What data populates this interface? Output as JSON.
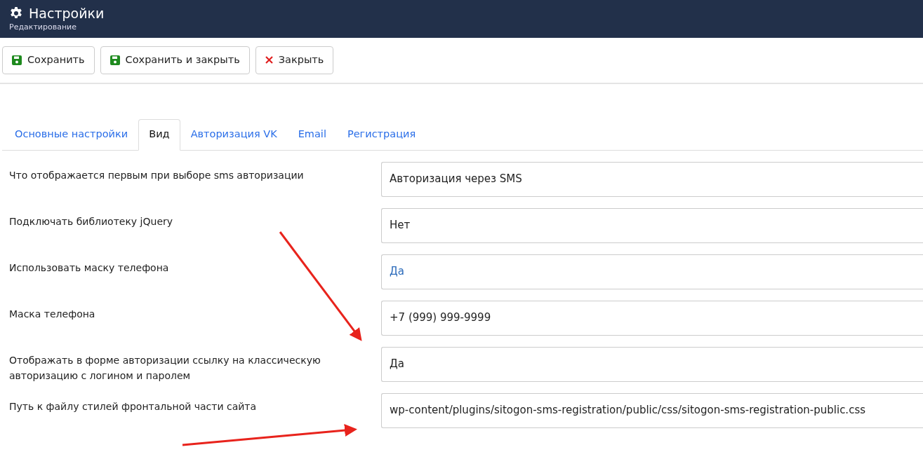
{
  "header": {
    "title": "Настройки",
    "subtitle": "Редактирование"
  },
  "toolbar": [
    {
      "label": "Сохранить",
      "kind": "save"
    },
    {
      "label": "Сохранить и закрыть",
      "kind": "save"
    },
    {
      "label": "Закрыть",
      "kind": "close"
    }
  ],
  "tabs": [
    {
      "label": "Основные настройки",
      "selected": false
    },
    {
      "label": "Вид",
      "selected": true
    },
    {
      "label": "Авторизация VK",
      "selected": false
    },
    {
      "label": "Email",
      "selected": false
    },
    {
      "label": "Регистрация",
      "selected": false
    }
  ],
  "fields": [
    {
      "label": "Что отображается первым при выборе sms авторизации",
      "value": "Авторизация через SMS",
      "highlighted": false
    },
    {
      "label": "Подключать библиотеку jQuery",
      "value": "Нет",
      "highlighted": false
    },
    {
      "label": "Использовать маску телефона",
      "value": "Да",
      "highlighted": true
    },
    {
      "label": "Маска телефона",
      "value": "+7 (999) 999-9999",
      "highlighted": false
    },
    {
      "label": "Отображать в форме авторизации ссылку на классическую авторизацию с логином и паролем",
      "value": "Да",
      "highlighted": false
    },
    {
      "label": "Путь к файлу стилей фронтальной части сайта",
      "value": "wp-content/plugins/sitogon-sms-registration/public/css/sitogon-sms-registration-public.css",
      "highlighted": false
    }
  ]
}
